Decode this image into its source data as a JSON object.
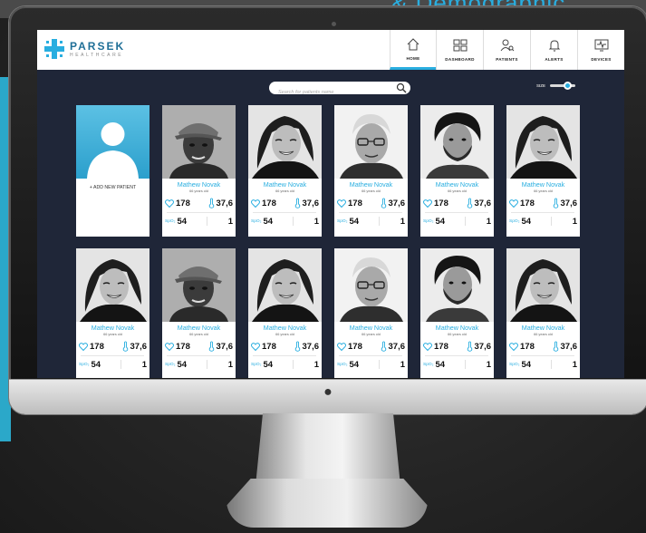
{
  "background": {
    "title": "& Demographic",
    "accent": "#29aee0"
  },
  "app": {
    "brand_name": "PARSEK",
    "brand_sub": "HEALTHCARE",
    "nav": [
      {
        "label": "HOME",
        "icon": "home-icon",
        "active": true
      },
      {
        "label": "DASHBOARD",
        "icon": "dashboard-icon"
      },
      {
        "label": "PATIENTS",
        "icon": "patients-icon"
      },
      {
        "label": "ALERTS",
        "icon": "bell-icon"
      },
      {
        "label": "DEVICES",
        "icon": "monitor-heartbeat-icon"
      }
    ],
    "search_placeholder": "Search for patients name",
    "size_label": "SIZE",
    "size_level": 0.7,
    "add_patient_label": "+ ADD NEW PATIENT",
    "spo_label": "SpO₂",
    "patients": [
      {
        "name": "Mathew Novak",
        "age": "66 years old",
        "heart": "178",
        "temp": "37,6",
        "spo2": "54",
        "count": "1",
        "photo": "elderly-man-cap"
      },
      {
        "name": "Mathew Novak",
        "age": "66 years old",
        "heart": "178",
        "temp": "37,6",
        "spo2": "54",
        "count": "1",
        "photo": "smiling-woman"
      },
      {
        "name": "Mathew Novak",
        "age": "66 years old",
        "heart": "178",
        "temp": "37,6",
        "spo2": "54",
        "count": "1",
        "photo": "old-man-glasses"
      },
      {
        "name": "Mathew Novak",
        "age": "66 years old",
        "heart": "178",
        "temp": "37,6",
        "spo2": "54",
        "count": "1",
        "photo": "bearded-man"
      },
      {
        "name": "Mathew Novak",
        "age": "66 years old",
        "heart": "178",
        "temp": "37,6",
        "spo2": "54",
        "count": "1",
        "photo": "smiling-woman"
      },
      {
        "name": "Mathew Novak",
        "age": "66 years old",
        "heart": "178",
        "temp": "37,6",
        "spo2": "54",
        "count": "1",
        "photo": "smiling-woman"
      },
      {
        "name": "Mathew Novak",
        "age": "66 years old",
        "heart": "178",
        "temp": "37,6",
        "spo2": "54",
        "count": "1",
        "photo": "elderly-man-cap"
      },
      {
        "name": "Mathew Novak",
        "age": "66 years old",
        "heart": "178",
        "temp": "37,6",
        "spo2": "54",
        "count": "1",
        "photo": "smiling-woman"
      },
      {
        "name": "Mathew Novak",
        "age": "66 years old",
        "heart": "178",
        "temp": "37,6",
        "spo2": "54",
        "count": "1",
        "photo": "old-man-glasses"
      },
      {
        "name": "Mathew Novak",
        "age": "66 years old",
        "heart": "178",
        "temp": "37,6",
        "spo2": "54",
        "count": "1",
        "photo": "bearded-man"
      },
      {
        "name": "Mathew Novak",
        "age": "66 years old",
        "heart": "178",
        "temp": "37,6",
        "spo2": "54",
        "count": "1",
        "photo": "smiling-woman"
      }
    ]
  }
}
